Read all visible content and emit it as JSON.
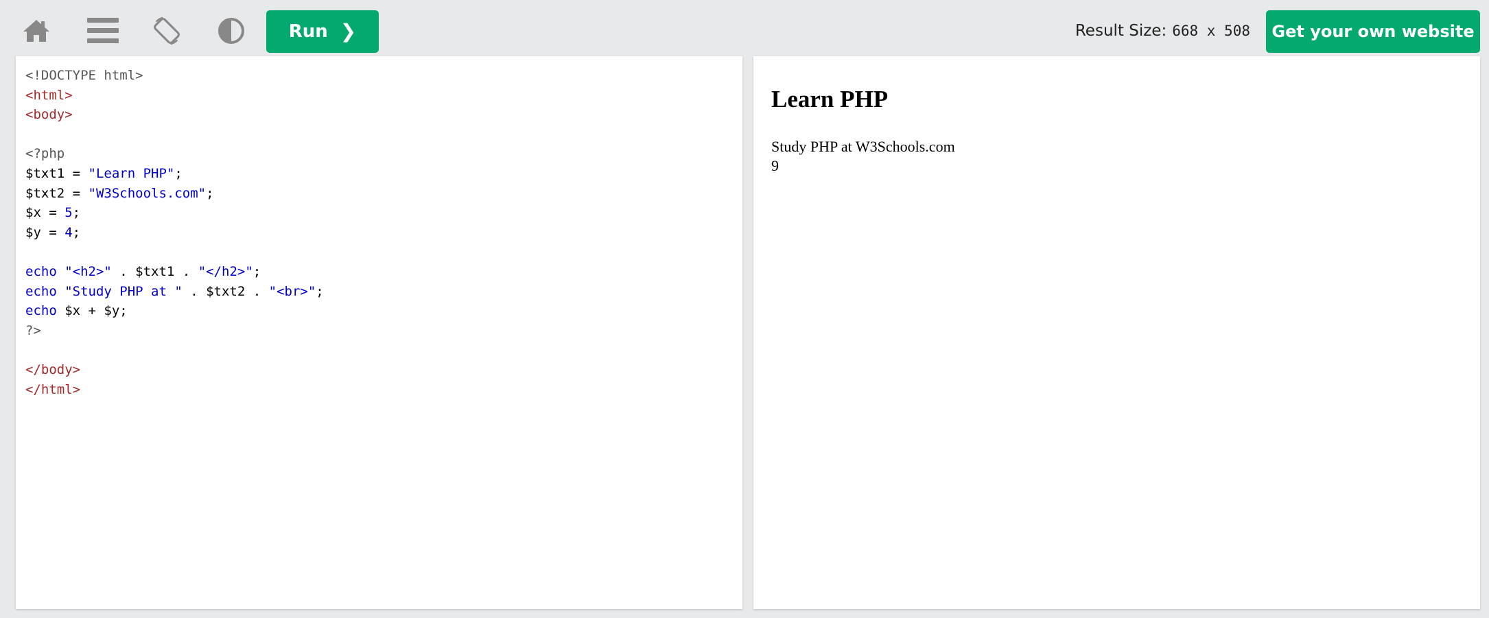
{
  "toolbar": {
    "icons": [
      "home-icon",
      "menu-icon",
      "rotate-icon",
      "contrast-icon"
    ],
    "run_label": "Run",
    "run_chevron": "❯",
    "result_size_label": "Result Size:",
    "result_size_value": "668 x 508",
    "get_website_label": "Get your own website"
  },
  "colors": {
    "accent": "#04aa6d",
    "background": "#e7e9eb",
    "icon": "#888888",
    "code_tag": "#a52a2a",
    "code_keyword": "#0000cd",
    "code_php": "#555555"
  },
  "code": {
    "lines": [
      {
        "t": "<!DOCTYPE html>"
      },
      {
        "t": "<html>"
      },
      {
        "t": "<body>"
      },
      {
        "t": ""
      },
      {
        "t": "<?php"
      },
      {
        "a": "$txt1 = ",
        "b": "\"Learn PHP\"",
        "c": ";"
      },
      {
        "a": "$txt2 = ",
        "b": "\"W3Schools.com\"",
        "c": ";"
      },
      {
        "a": "$x = ",
        "b": "5",
        "c": ";"
      },
      {
        "a": "$y = ",
        "b": "4",
        "c": ";"
      },
      {
        "t": ""
      },
      {
        "a": "echo ",
        "b": "\"<h2>\"",
        "c": " . $txt1 . ",
        "d": "\"</h2>\"",
        "e": ";"
      },
      {
        "a": "echo ",
        "b": "\"Study PHP at \"",
        "c": " . $txt2 . ",
        "d": "\"<br>\"",
        "e": ";"
      },
      {
        "a": "echo ",
        "c": "$x + $y;"
      },
      {
        "t": "?>"
      },
      {
        "t": ""
      },
      {
        "t": "</body>"
      },
      {
        "t": "</html>"
      }
    ]
  },
  "result": {
    "heading": "Learn PHP",
    "line1": "Study PHP at W3Schools.com",
    "line2": "9"
  }
}
